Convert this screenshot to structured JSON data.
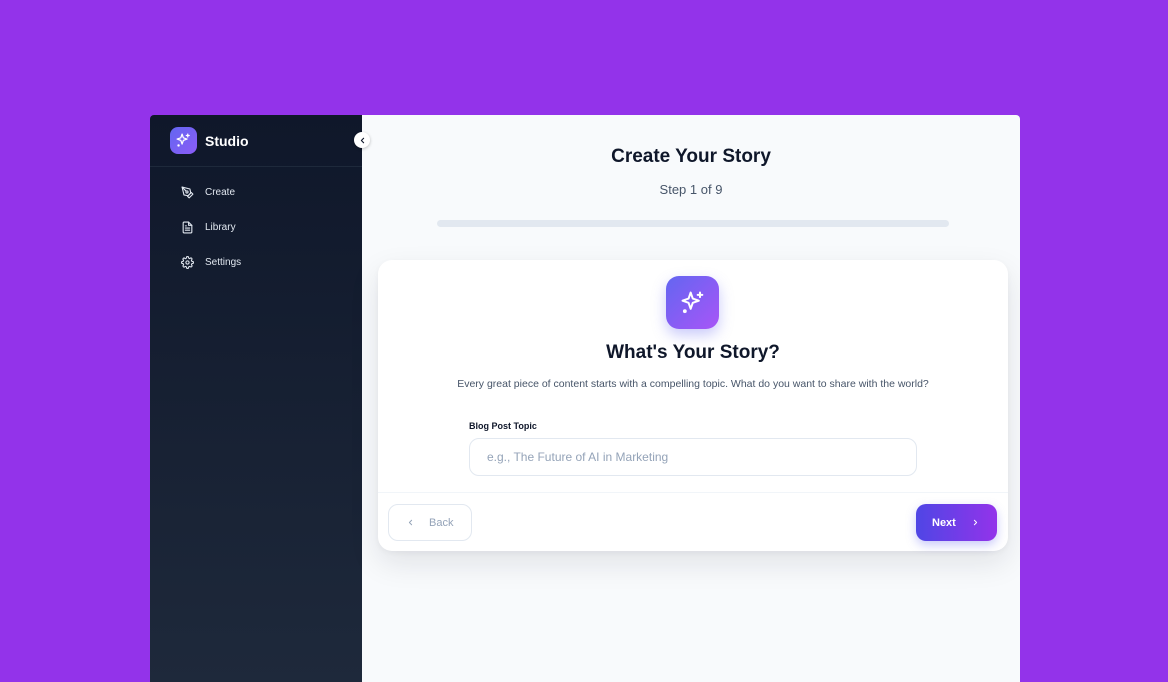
{
  "sidebar": {
    "brand": "Studio",
    "items": [
      {
        "label": "Create",
        "icon": "pen-tool-icon"
      },
      {
        "label": "Library",
        "icon": "document-icon"
      },
      {
        "label": "Settings",
        "icon": "gear-icon"
      }
    ]
  },
  "header": {
    "title": "Create Your Story",
    "step_label": "Step 1 of 9",
    "progress": 0
  },
  "card": {
    "icon": "sparkles-icon",
    "heading": "What's Your Story?",
    "description": "Every great piece of content starts with a compelling topic. What do you want to share with the world?",
    "field_label": "Blog Post Topic",
    "field_value": "",
    "field_placeholder": "e.g., The Future of AI in Marketing",
    "back_label": "Back",
    "next_label": "Next"
  },
  "colors": {
    "background": "#9333ea",
    "sidebar": "#0f172a",
    "accent_start": "#4f46e5",
    "accent_end": "#9333ea"
  }
}
